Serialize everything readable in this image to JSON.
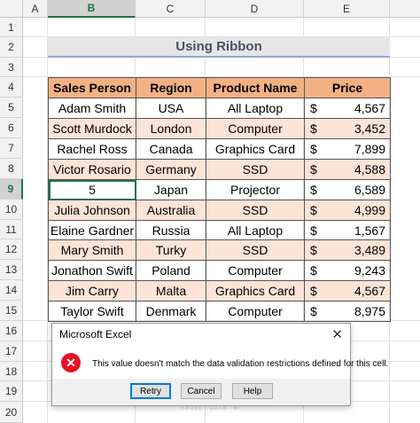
{
  "columns": [
    "A",
    "B",
    "C",
    "D",
    "E"
  ],
  "rows": [
    "1",
    "2",
    "3",
    "4",
    "5",
    "6",
    "7",
    "8",
    "9",
    "10",
    "11",
    "12",
    "13",
    "14",
    "15",
    "16",
    "17",
    "18",
    "19",
    "20"
  ],
  "selected_column": "B",
  "selected_row": "9",
  "title": "Using Ribbon",
  "headers": [
    "Sales Person",
    "Region",
    "Product Name",
    "Price"
  ],
  "table": [
    {
      "name": "Adam Smith",
      "region": "USA",
      "product": "All Laptop",
      "currency": "$",
      "price": "4,567"
    },
    {
      "name": "Scott Murdock",
      "region": "London",
      "product": "Computer",
      "currency": "$",
      "price": "3,452"
    },
    {
      "name": "Rachel Ross",
      "region": "Canada",
      "product": "Graphics Card",
      "currency": "$",
      "price": "7,899"
    },
    {
      "name": "Victor Rosario",
      "region": "Germany",
      "product": "SSD",
      "currency": "$",
      "price": "4,588"
    },
    {
      "name": "5",
      "region": "Japan",
      "product": "Projector",
      "currency": "$",
      "price": "6,589"
    },
    {
      "name": "Julia Johnson",
      "region": "Australia",
      "product": "SSD",
      "currency": "$",
      "price": "4,999"
    },
    {
      "name": "Elaine Gardner",
      "region": "Russia",
      "product": "All Laptop",
      "currency": "$",
      "price": "1,567"
    },
    {
      "name": "Mary Smith",
      "region": "Turky",
      "product": "SSD",
      "currency": "$",
      "price": "3,489"
    },
    {
      "name": "Jonathon Swift",
      "region": "Poland",
      "product": "Computer",
      "currency": "$",
      "price": "9,243"
    },
    {
      "name": "Jim Carry",
      "region": "Malta",
      "product": "Graphics Card",
      "currency": "$",
      "price": "4,567"
    },
    {
      "name": "Taylor Swift",
      "region": "Denmark",
      "product": "Computer",
      "currency": "$",
      "price": "8,975"
    }
  ],
  "dialog": {
    "title": "Microsoft Excel",
    "close_label": "✕",
    "icon": "error-icon",
    "icon_glyph": "✕",
    "message": "This value doesn't match the data validation restrictions defined for this cell.",
    "buttons": {
      "retry": "Retry",
      "cancel": "Cancel",
      "help": "Help"
    }
  },
  "watermark": {
    "brand": "exceldemy",
    "tagline": "EXCEL · DATA · BI"
  },
  "colors": {
    "header_fill": "#f4b183",
    "alt_row_fill": "#fce4d6",
    "title_fill": "#e7e6e6",
    "selection": "#217346",
    "error": "#e81123"
  }
}
